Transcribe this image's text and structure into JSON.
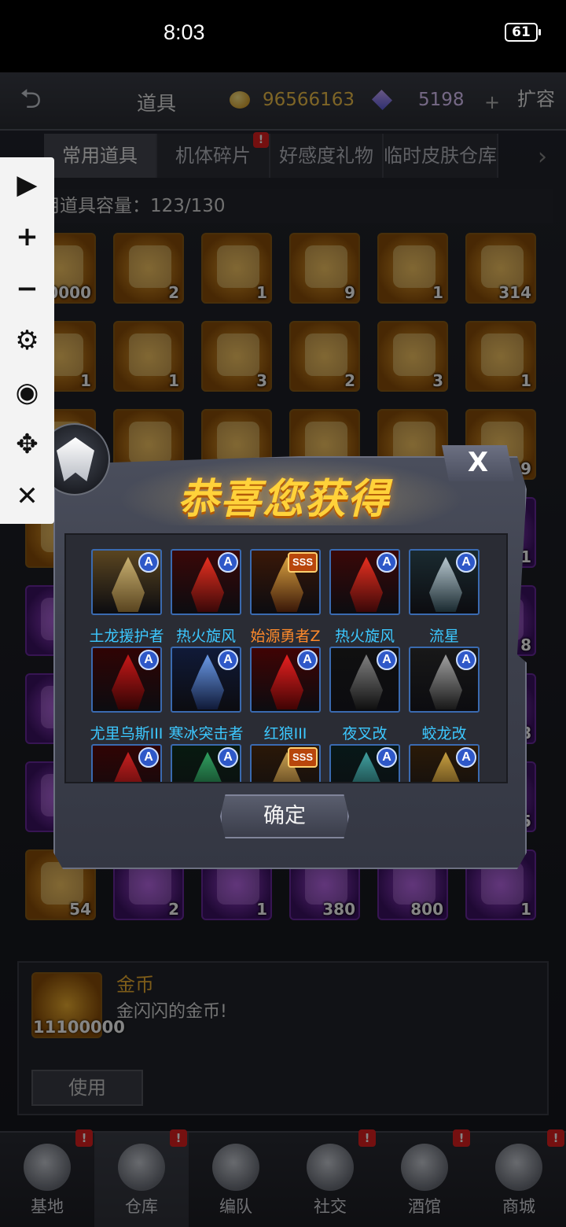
{
  "status_bar": {
    "time": "8:03",
    "battery": "61"
  },
  "header": {
    "back_icon": "back-arrow-icon",
    "title": "道具",
    "coins": "96566163",
    "gems": "5198",
    "expand_label": "扩容"
  },
  "tabs": [
    {
      "label": "常用道具",
      "active": true
    },
    {
      "label": "机体碎片",
      "badge": "!"
    },
    {
      "label": "好感度礼物"
    },
    {
      "label": "临时皮肤仓库"
    }
  ],
  "capacity": "常用道具容量：123/130",
  "inventory": [
    {
      "count": "11100000",
      "color": "gold"
    },
    {
      "count": "2",
      "color": "gold"
    },
    {
      "count": "1",
      "color": "gold"
    },
    {
      "count": "9",
      "color": "gold"
    },
    {
      "count": "1",
      "color": "gold"
    },
    {
      "count": "314",
      "color": "gold"
    },
    {
      "count": "1",
      "color": "gold"
    },
    {
      "count": "1",
      "color": "gold"
    },
    {
      "count": "3",
      "color": "gold"
    },
    {
      "count": "2",
      "color": "gold"
    },
    {
      "count": "3",
      "color": "gold"
    },
    {
      "count": "1",
      "color": "gold"
    },
    {
      "count": "",
      "color": "gold"
    },
    {
      "count": "",
      "color": "gold"
    },
    {
      "count": "",
      "color": "gold"
    },
    {
      "count": "",
      "color": "gold"
    },
    {
      "count": "",
      "color": "gold"
    },
    {
      "count": "39",
      "color": "gold"
    },
    {
      "count": "",
      "color": "gold"
    },
    {
      "count": "",
      "color": "purple"
    },
    {
      "count": "",
      "color": "purple"
    },
    {
      "count": "",
      "color": "purple"
    },
    {
      "count": "",
      "color": "purple"
    },
    {
      "count": "11",
      "color": "purple"
    },
    {
      "count": "",
      "color": "purple"
    },
    {
      "count": "",
      "color": "purple"
    },
    {
      "count": "",
      "color": "purple"
    },
    {
      "count": "",
      "color": "purple"
    },
    {
      "count": "",
      "color": "purple"
    },
    {
      "count": "8",
      "color": "purple"
    },
    {
      "count": "",
      "color": "purple"
    },
    {
      "count": "",
      "color": "purple"
    },
    {
      "count": "",
      "color": "purple"
    },
    {
      "count": "",
      "color": "purple"
    },
    {
      "count": "",
      "color": "purple"
    },
    {
      "count": "8",
      "color": "purple"
    },
    {
      "count": "",
      "color": "purple"
    },
    {
      "count": "",
      "color": "purple"
    },
    {
      "count": "",
      "color": "purple"
    },
    {
      "count": "",
      "color": "purple"
    },
    {
      "count": "",
      "color": "purple"
    },
    {
      "count": "5",
      "color": "purple"
    },
    {
      "count": "54",
      "color": "gold"
    },
    {
      "count": "2",
      "color": "purple"
    },
    {
      "count": "1",
      "color": "purple"
    },
    {
      "count": "380",
      "color": "purple"
    },
    {
      "count": "800",
      "color": "purple"
    },
    {
      "count": "1",
      "color": "purple"
    }
  ],
  "detail": {
    "count": "11100000",
    "name": "金币",
    "description": "金闪闪的金币!",
    "use_label": "使用"
  },
  "bottom_nav": [
    {
      "label": "基地",
      "badge": "!"
    },
    {
      "label": "仓库",
      "badge": "!",
      "active": true
    },
    {
      "label": "编队"
    },
    {
      "label": "社交",
      "badge": "!"
    },
    {
      "label": "酒馆",
      "badge": "!"
    },
    {
      "label": "商城",
      "badge": "!"
    }
  ],
  "tool_panel": [
    "play-icon",
    "plus-icon",
    "minus-icon",
    "gear-icon",
    "eye-icon",
    "move-icon",
    "close-icon"
  ],
  "modal": {
    "title": "恭喜您获得",
    "close_label": "X",
    "confirm_label": "确定",
    "rewards": [
      {
        "name": "土龙援护者",
        "rank": "A",
        "name_color": "blue",
        "palette": [
          "#c8b070",
          "#5a4520"
        ]
      },
      {
        "name": "热火旋风",
        "rank": "A",
        "name_color": "blue",
        "palette": [
          "#e83020",
          "#3a0808"
        ]
      },
      {
        "name": "始源勇者Z",
        "rank": "SSS",
        "name_color": "orange",
        "palette": [
          "#d8a040",
          "#3a1808"
        ]
      },
      {
        "name": "热火旋风",
        "rank": "A",
        "name_color": "blue",
        "palette": [
          "#e83020",
          "#3a0808"
        ]
      },
      {
        "name": "流星",
        "rank": "A",
        "name_color": "blue",
        "palette": [
          "#b8c8d0",
          "#1a2a30"
        ]
      },
      {
        "name": "尤里乌斯III",
        "rank": "A",
        "name_color": "blue",
        "palette": [
          "#c81818",
          "#300404"
        ]
      },
      {
        "name": "寒冰突击者",
        "rank": "A",
        "name_color": "blue",
        "palette": [
          "#6a9ae8",
          "#101a38"
        ]
      },
      {
        "name": "红狼III",
        "rank": "A",
        "name_color": "blue",
        "palette": [
          "#e82020",
          "#400404"
        ]
      },
      {
        "name": "夜叉改",
        "rank": "A",
        "name_color": "blue",
        "palette": [
          "#808080",
          "#101010"
        ]
      },
      {
        "name": "蛟龙改",
        "rank": "A",
        "name_color": "blue",
        "palette": [
          "#a0a0a0",
          "#181818"
        ]
      },
      {
        "name": "",
        "rank": "A",
        "name_color": "blue",
        "palette": [
          "#c82020",
          "#300404"
        ]
      },
      {
        "name": "",
        "rank": "A",
        "name_color": "blue",
        "palette": [
          "#30a060",
          "#081a10"
        ]
      },
      {
        "name": "",
        "rank": "SSS",
        "name_color": "orange",
        "palette": [
          "#c8a050",
          "#2a1808"
        ]
      },
      {
        "name": "",
        "rank": "A",
        "name_color": "blue",
        "palette": [
          "#40a0a0",
          "#081818"
        ]
      },
      {
        "name": "",
        "rank": "A",
        "name_color": "blue",
        "palette": [
          "#c8a040",
          "#2a1a08"
        ]
      }
    ]
  }
}
